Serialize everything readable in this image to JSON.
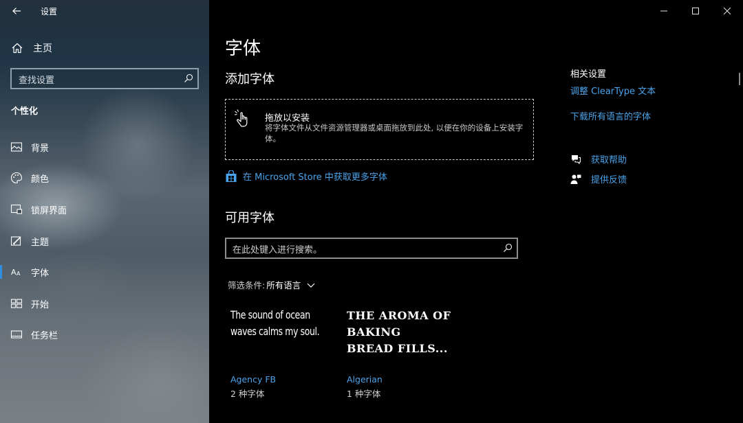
{
  "app": {
    "title": "设置"
  },
  "sidebar": {
    "home_label": "主页",
    "search_placeholder": "查找设置",
    "section_title": "个性化",
    "items": [
      {
        "label": "背景",
        "icon": "picture-icon"
      },
      {
        "label": "颜色",
        "icon": "palette-icon"
      },
      {
        "label": "锁屏界面",
        "icon": "lock-screen-icon"
      },
      {
        "label": "主题",
        "icon": "theme-icon"
      },
      {
        "label": "字体",
        "icon": "font-icon",
        "active": true
      },
      {
        "label": "开始",
        "icon": "start-icon"
      },
      {
        "label": "任务栏",
        "icon": "taskbar-icon"
      }
    ]
  },
  "main": {
    "page_title": "字体",
    "add_fonts_heading": "添加字体",
    "drop_zone": {
      "title": "拖放以安装",
      "description": "将字体文件从文件资源管理器或桌面拖放到此处, 以便在你的设备上安装字体。"
    },
    "store_link": "在 Microsoft Store 中获取更多字体",
    "available_heading": "可用字体",
    "font_search_placeholder": "在此处键入进行搜索。",
    "filter": {
      "label": "筛选条件:",
      "value": "所有语言"
    },
    "fonts": [
      {
        "sample_lines": [
          "The sound of ocean",
          "waves calms my soul."
        ],
        "name": "Agency FB",
        "count": "2 种字体"
      },
      {
        "sample_lines": [
          "THE AROMA OF",
          "BAKING",
          "BREAD FILLS..."
        ],
        "name": "Algerian",
        "count": "1 种字体"
      }
    ]
  },
  "related": {
    "title": "相关设置",
    "links": [
      "调整 ClearType 文本",
      "下载所有语言的字体"
    ],
    "help": {
      "get_help": "获取帮助",
      "feedback": "提供反馈"
    }
  },
  "colors": {
    "accent": "#2f8ee0",
    "link": "#4aa3ea",
    "background": "#000000"
  }
}
